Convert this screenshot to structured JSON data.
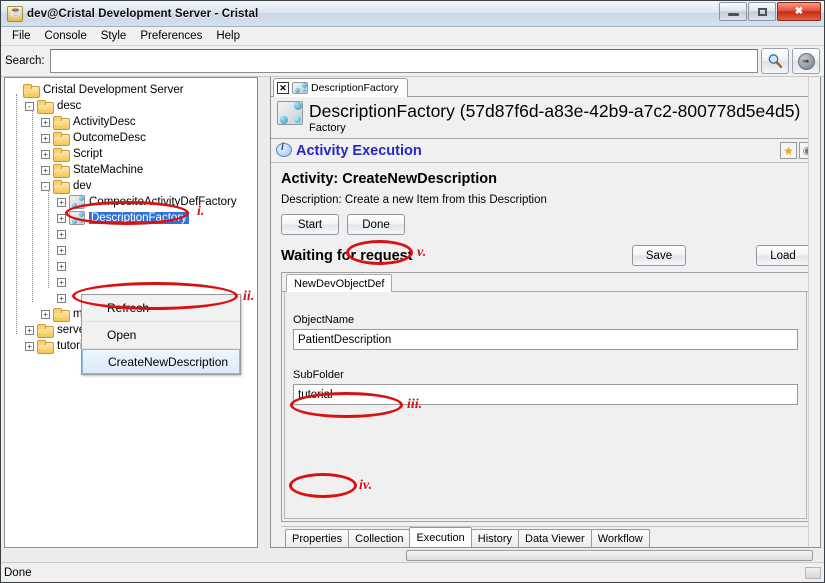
{
  "window": {
    "title": "dev@Cristal Development Server - Cristal",
    "app_icon": "java-coffee-icon",
    "minimize_label": "",
    "maximize_label": "",
    "close_label": "✖"
  },
  "menubar": {
    "items": [
      {
        "label": "File"
      },
      {
        "label": "Console"
      },
      {
        "label": "Style"
      },
      {
        "label": "Preferences"
      },
      {
        "label": "Help"
      }
    ]
  },
  "search": {
    "label": "Search:",
    "value": "",
    "placeholder": "",
    "search_icon": "magnifier-icon",
    "go_icon": "arrow-right-icon"
  },
  "tree": {
    "root": "Cristal Development Server",
    "nodes": [
      {
        "label": "Cristal Development Server",
        "depth": 0,
        "handle": "",
        "icon": "folder-icon"
      },
      {
        "label": "desc",
        "depth": 1,
        "handle": "-",
        "icon": "folder-icon"
      },
      {
        "label": "ActivityDesc",
        "depth": 2,
        "handle": "+",
        "icon": "folder-icon"
      },
      {
        "label": "OutcomeDesc",
        "depth": 2,
        "handle": "+",
        "icon": "folder-icon"
      },
      {
        "label": "Script",
        "depth": 2,
        "handle": "+",
        "icon": "folder-icon"
      },
      {
        "label": "StateMachine",
        "depth": 2,
        "handle": "+",
        "icon": "folder-icon"
      },
      {
        "label": "dev",
        "depth": 2,
        "handle": "-",
        "icon": "folder-icon"
      },
      {
        "label": "CompositeActivityDefFactory",
        "depth": 3,
        "handle": "+",
        "icon": "factory-icon"
      },
      {
        "label": "DescriptionFactory",
        "depth": 3,
        "handle": "+",
        "icon": "factory-icon",
        "selected": true
      },
      {
        "label": "",
        "depth": 3,
        "handle": "+",
        "icon": ""
      },
      {
        "label": "",
        "depth": 3,
        "handle": "+",
        "icon": ""
      },
      {
        "label": "",
        "depth": 3,
        "handle": "+",
        "icon": ""
      },
      {
        "label": "",
        "depth": 3,
        "handle": "+",
        "icon": ""
      },
      {
        "label": "",
        "depth": 3,
        "handle": "+",
        "icon": ""
      },
      {
        "label": "modules",
        "depth": 2,
        "handle": "+",
        "icon": "folder-icon"
      },
      {
        "label": "servers",
        "depth": 1,
        "handle": "+",
        "icon": "folder-icon"
      },
      {
        "label": "tutorial",
        "depth": 1,
        "handle": "+",
        "icon": "folder-icon"
      }
    ]
  },
  "context_menu": {
    "items": [
      {
        "label": "Refresh",
        "highlighted": false
      },
      {
        "label": "Open",
        "highlighted": false
      },
      {
        "label": "CreateNewDescription",
        "highlighted": true
      }
    ]
  },
  "editor": {
    "tab": {
      "label": "DescriptionFactory",
      "close_icon": "close-x-icon",
      "icon": "factory-icon"
    },
    "header": {
      "title": "DescriptionFactory (57d87f6d-a83e-42b9-a7c2-800778d5e4d5)",
      "subtitle": "Factory",
      "icon": "factory-icon"
    },
    "section": {
      "title": "Activity Execution",
      "info_icon": "info-balloon-icon",
      "favorite_icon": "star-icon",
      "reload_icon": "refresh-icon"
    },
    "activity": {
      "title": "Activity: CreateNewDescription",
      "description": "Description: Create a new Item from this Description",
      "start_label": "Start",
      "done_label": "Done",
      "status": "Waiting for request",
      "save_label": "Save",
      "load_label": "Load"
    },
    "form": {
      "tab_label": "NewDevObjectDef",
      "fields": [
        {
          "label": "ObjectName",
          "value": "PatientDescription"
        },
        {
          "label": "SubFolder",
          "value": "tutorial"
        }
      ]
    },
    "bottom_tabs": [
      {
        "label": "Properties",
        "active": false
      },
      {
        "label": "Collection",
        "active": false
      },
      {
        "label": "Execution",
        "active": true
      },
      {
        "label": "History",
        "active": false
      },
      {
        "label": "Data Viewer",
        "active": false
      },
      {
        "label": "Workflow",
        "active": false
      }
    ]
  },
  "statusbar": {
    "text": "Done"
  },
  "annotations": {
    "color": "#d81212",
    "markers": [
      {
        "id": "i",
        "label": "i.",
        "target": "tree-node-descriptionfactory"
      },
      {
        "id": "ii",
        "label": "ii.",
        "target": "context-menu-createnewdescription"
      },
      {
        "id": "iii",
        "label": "iii.",
        "target": "objectname-input"
      },
      {
        "id": "iv",
        "label": "iv.",
        "target": "subfolder-input"
      },
      {
        "id": "v",
        "label": "v.",
        "target": "done-button"
      }
    ]
  }
}
